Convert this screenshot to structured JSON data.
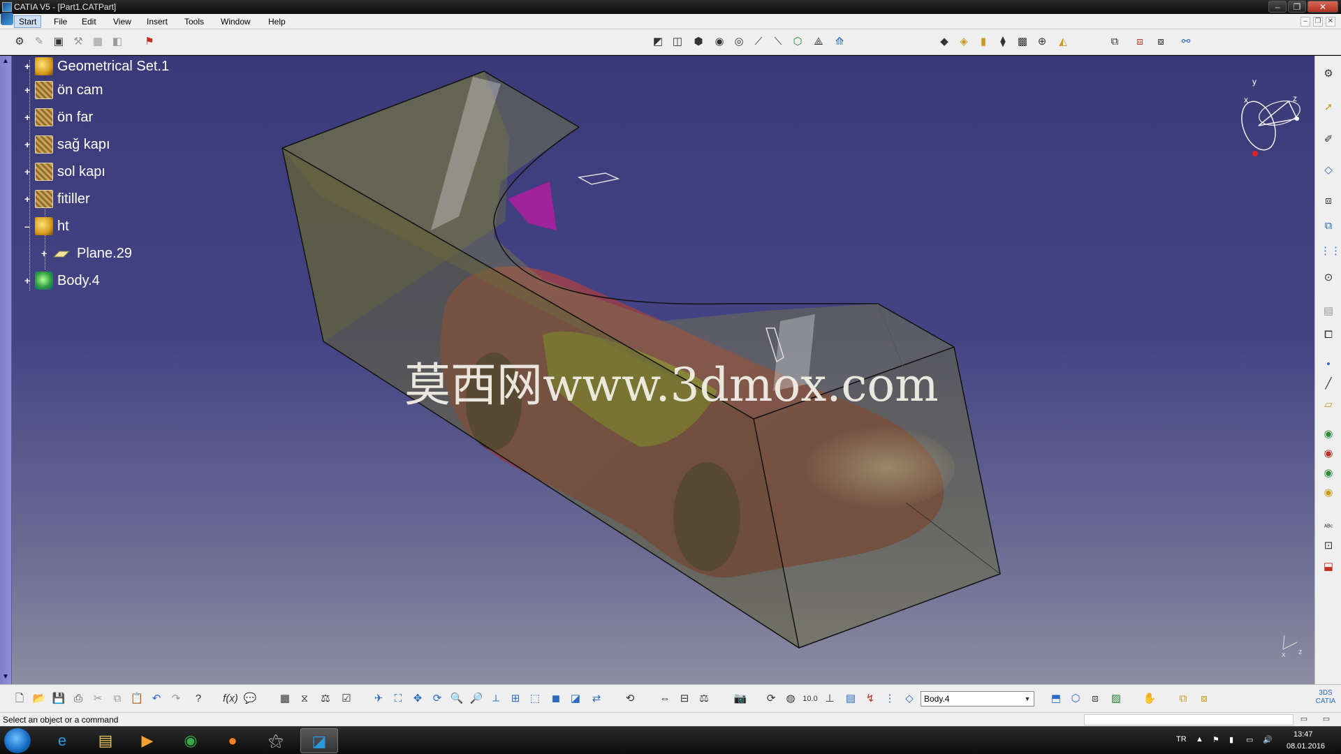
{
  "window": {
    "title": "CATIA V5 - [Part1.CATPart]",
    "buttons": [
      "–",
      "❐",
      "✕"
    ]
  },
  "menu": {
    "items": [
      "Start",
      "File",
      "Edit",
      "View",
      "Insert",
      "Tools",
      "Window",
      "Help"
    ],
    "mdi_buttons": [
      "–",
      "❐",
      "✕"
    ]
  },
  "tree": {
    "items": [
      {
        "label": "Geometrical Set.1",
        "icon": "geometrical-set-icon"
      },
      {
        "label": "ön cam",
        "icon": "sketch-icon"
      },
      {
        "label": "ön far",
        "icon": "sketch-icon"
      },
      {
        "label": "sağ kapı",
        "icon": "sketch-icon"
      },
      {
        "label": "sol kapı",
        "icon": "sketch-icon"
      },
      {
        "label": "fitiller",
        "icon": "sketch-icon"
      },
      {
        "label": "ht",
        "icon": "geometrical-set-icon"
      },
      {
        "label": "Plane.29",
        "icon": "plane-icon"
      },
      {
        "label": "Body.4",
        "icon": "body-icon"
      }
    ]
  },
  "viewport": {
    "watermark": "莫西网www.3dmox.com",
    "compass_labels": {
      "x": "x",
      "y": "y",
      "z": "z"
    },
    "corner_axis_labels": {
      "x": "x",
      "z": "z"
    }
  },
  "toolbar": {
    "current_body": "Body.4"
  },
  "status": {
    "prompt": "Select an object or a command"
  },
  "taskbar": {
    "language": "TR",
    "time": "13:47",
    "date": "08.01.2016"
  },
  "colors": {
    "viewport_top": "#3a3a78",
    "viewport_bottom": "#8d8da2",
    "model_box": "#6f6e3e",
    "car_body": "#8a3a4a",
    "windshield": "#8f8f2a"
  }
}
